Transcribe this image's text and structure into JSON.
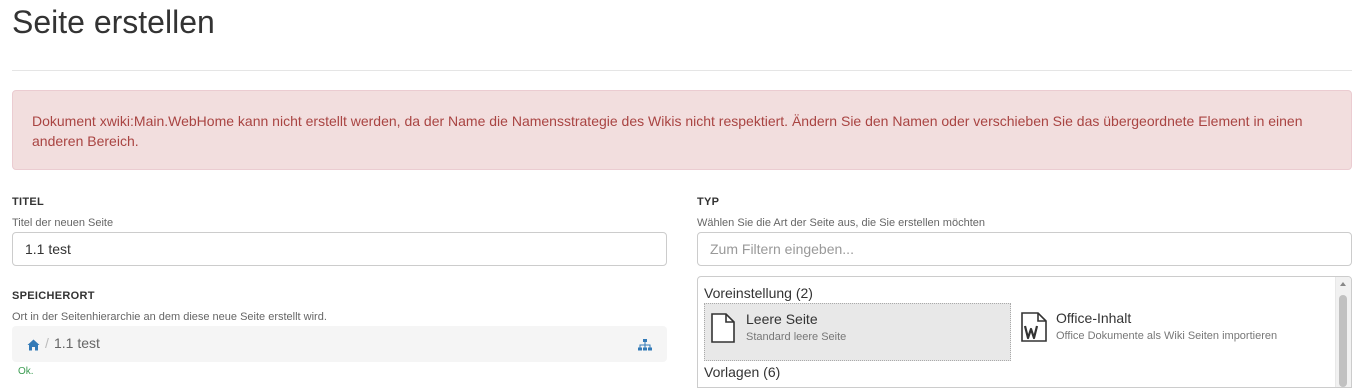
{
  "page": {
    "title": "Seite erstellen"
  },
  "alert": {
    "message": "Dokument xwiki:Main.WebHome kann nicht erstellt werden, da der Name die Namensstrategie des Wikis nicht respektiert. Ändern Sie den Namen oder verschieben Sie das übergeordnete Element in einen anderen Bereich."
  },
  "title_field": {
    "label": "TITEL",
    "hint": "Titel der neuen Seite",
    "value": "1.1 test"
  },
  "location_field": {
    "label": "SPEICHERORT",
    "hint": "Ort in der Seitenhierarchie an dem diese neue Seite erstellt wird.",
    "breadcrumb_separator": "/",
    "breadcrumb_page": "1.1 test",
    "status": "Ok.",
    "home_icon": "home-icon",
    "tree_icon": "sitemap-icon"
  },
  "type_field": {
    "label": "TYP",
    "hint": "Wählen Sie die Art der Seite aus, die Sie erstellen möchten",
    "filter_placeholder": "Zum Filtern eingeben...",
    "groups": [
      {
        "title": "Voreinstellung (2)",
        "items": [
          {
            "name": "Leere Seite",
            "description": "Standard leere Seite",
            "icon": "blank-page-icon",
            "selected": true
          },
          {
            "name": "Office-Inhalt",
            "description": "Office Dokumente als Wiki Seiten importieren",
            "icon": "word-document-icon",
            "selected": false
          }
        ]
      },
      {
        "title": "Vorlagen (6)",
        "items": []
      }
    ]
  },
  "colors": {
    "alert_bg": "#f2dede",
    "alert_text": "#a94442",
    "ok_text": "#3c9c52",
    "link_blue": "#337ab7"
  }
}
